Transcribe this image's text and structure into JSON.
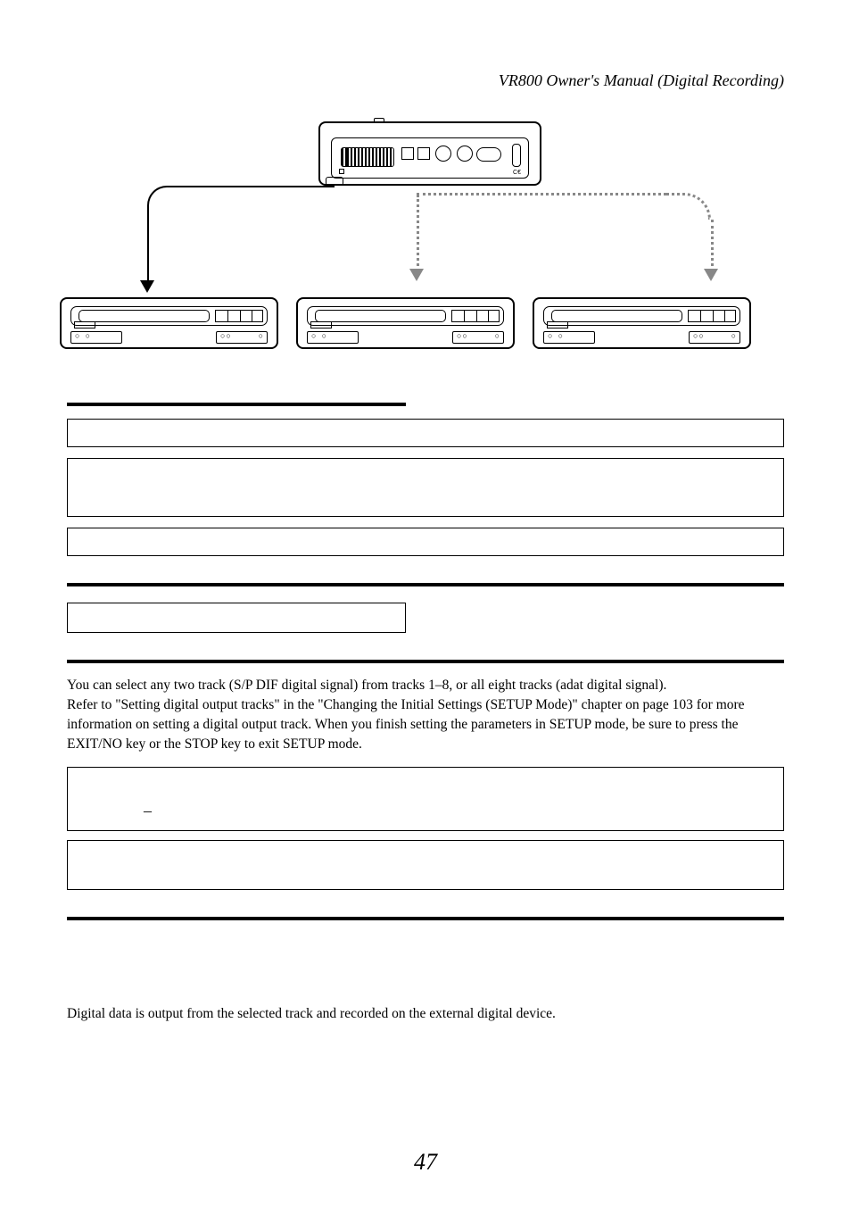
{
  "header": "VR800 Owner's Manual (Digital Recording)",
  "body_p1": "You can select any two track (S/P DIF digital signal) from tracks 1–8, or all eight tracks (adat digital signal).",
  "body_p2": "Refer to \"Setting digital output tracks\" in the \"Changing the Initial Settings (SETUP Mode)\" chapter on page 103 for more information on setting a digital output track.  When you finish setting the parameters in SETUP mode, be sure to press the EXIT/NO key or the STOP key to exit SETUP mode.",
  "footer_text": "Digital data is output from the selected track and recorded on the external digital device.",
  "page_number": "47"
}
